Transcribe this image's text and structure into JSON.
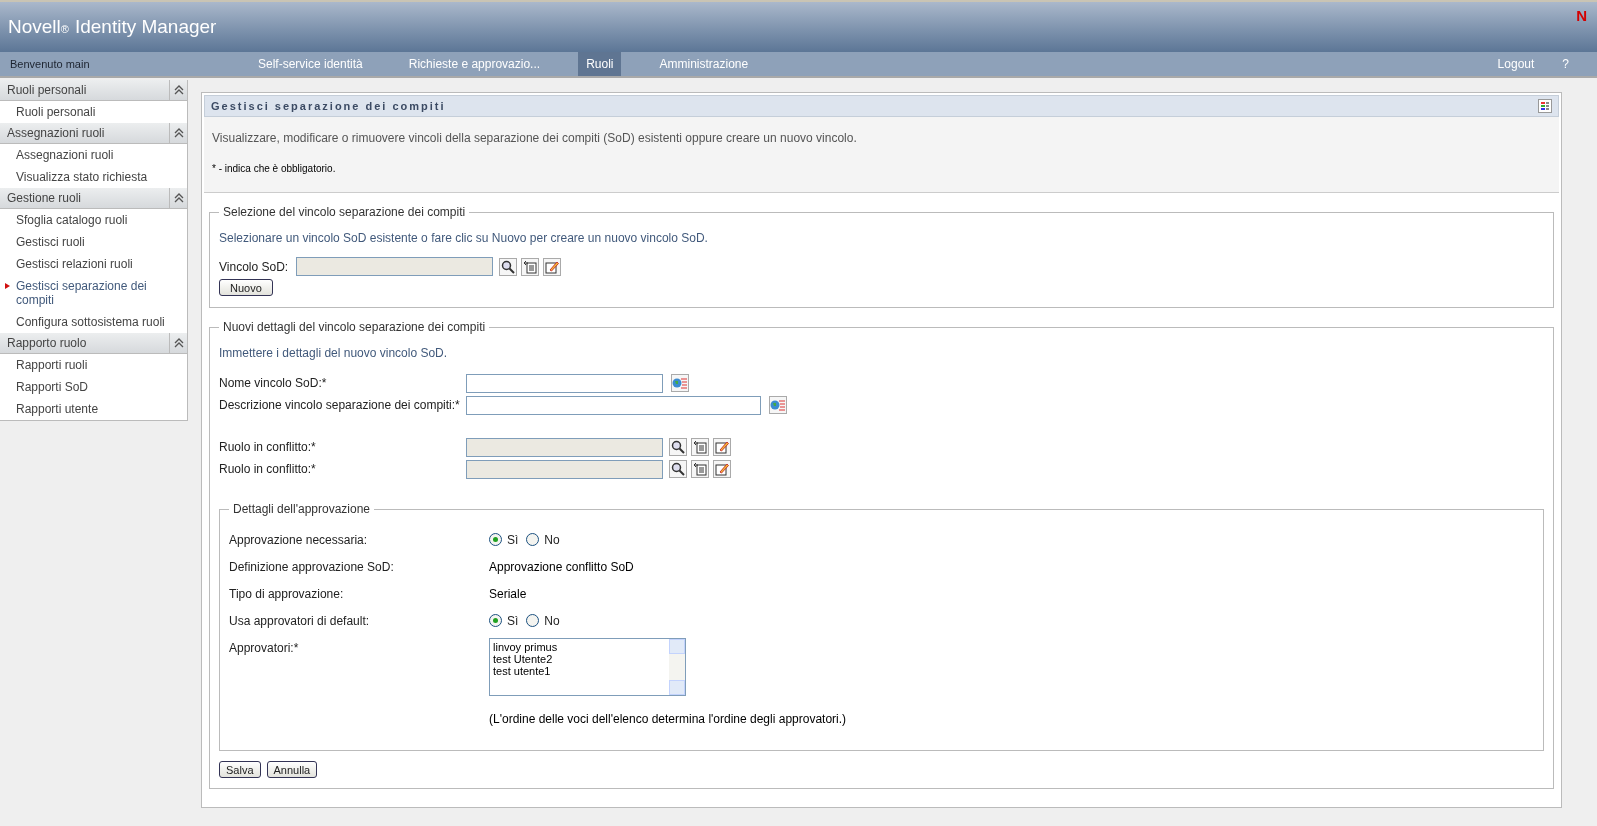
{
  "header": {
    "brand": "Novell",
    "brand_mark": "®",
    "product": "Identity Manager",
    "logo": "N"
  },
  "nav": {
    "welcome": "Benvenuto main",
    "tabs": [
      {
        "label": "Self-service identità",
        "selected": false
      },
      {
        "label": "Richieste e approvazio...",
        "selected": false
      },
      {
        "label": "Ruoli",
        "selected": true
      },
      {
        "label": "Amministrazione",
        "selected": false
      }
    ],
    "right": [
      "Logout",
      "?"
    ]
  },
  "sidebar": [
    {
      "title": "Ruoli personali",
      "items": [
        {
          "label": "Ruoli personali",
          "selected": false
        }
      ]
    },
    {
      "title": "Assegnazioni ruoli",
      "items": [
        {
          "label": "Assegnazioni ruoli",
          "selected": false
        },
        {
          "label": "Visualizza stato richiesta",
          "selected": false
        }
      ]
    },
    {
      "title": "Gestione ruoli",
      "items": [
        {
          "label": "Sfoglia catalogo ruoli",
          "selected": false
        },
        {
          "label": "Gestisci ruoli",
          "selected": false
        },
        {
          "label": "Gestisci relazioni ruoli",
          "selected": false
        },
        {
          "label": "Gestisci separazione dei compiti",
          "selected": true
        },
        {
          "label": "Configura sottosistema ruoli",
          "selected": false
        }
      ]
    },
    {
      "title": "Rapporto ruolo",
      "items": [
        {
          "label": "Rapporti ruoli",
          "selected": false
        },
        {
          "label": "Rapporti SoD",
          "selected": false
        },
        {
          "label": "Rapporti utente",
          "selected": false
        }
      ]
    }
  ],
  "panel": {
    "title": "Gestisci separazione dei compiti",
    "description": "Visualizzare, modificare o rimuovere vincoli della separazione dei compiti (SoD) esistenti oppure creare un nuovo vincolo.",
    "required_note": "* - indica che è obbligatorio."
  },
  "selection": {
    "legend": "Selezione del vincolo separazione dei compiti",
    "hint": "Selezionare un vincolo SoD esistente o fare clic su Nuovo per creare un nuovo vincolo SoD.",
    "field_label": "Vincolo SoD:",
    "button": "Nuovo"
  },
  "details": {
    "legend": "Nuovi dettagli del vincolo separazione dei compiti",
    "hint": "Immettere i dettagli del nuovo vincolo SoD.",
    "fields": [
      {
        "kind": "text",
        "label": "Nome vincolo SoD:*"
      },
      {
        "kind": "textwide",
        "label": "Descrizione vincolo separazione dei compiti:*"
      },
      {
        "kind": "spacer"
      },
      {
        "kind": "picker",
        "label": "Ruolo in conflitto:*"
      },
      {
        "kind": "picker",
        "label": "Ruolo in conflitto:*"
      }
    ]
  },
  "approval": {
    "legend": "Dettagli dell'approvazione",
    "rows": [
      {
        "kind": "radio",
        "label": "Approvazione necessaria:",
        "options": [
          {
            "label": "Sì",
            "selected": true
          },
          {
            "label": "No",
            "selected": false
          }
        ]
      },
      {
        "kind": "value",
        "label": "Definizione approvazione SoD:",
        "value": "Approvazione conflitto SoD"
      },
      {
        "kind": "value",
        "label": "Tipo di approvazione:",
        "value": "Seriale"
      },
      {
        "kind": "radio",
        "label": "Usa approvatori di default:",
        "options": [
          {
            "label": "Sì",
            "selected": true
          },
          {
            "label": "No",
            "selected": false
          }
        ]
      },
      {
        "kind": "list",
        "label": "Approvatori:*",
        "items": [
          "linvoy primus",
          "test Utente2",
          "test utente1"
        ],
        "note": "(L'ordine delle voci dell'elenco determina l'ordine degli approvatori.)"
      }
    ]
  },
  "buttons": [
    "Salva",
    "Annulla"
  ]
}
